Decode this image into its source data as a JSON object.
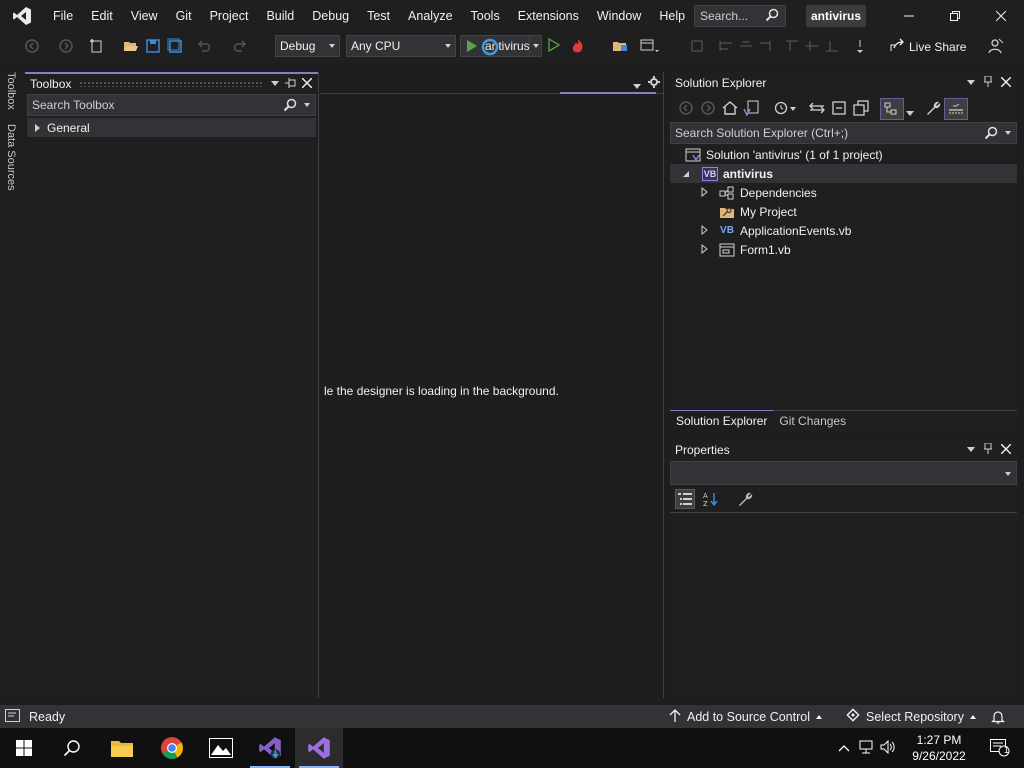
{
  "menu": {
    "items": [
      "File",
      "Edit",
      "View",
      "Git",
      "Project",
      "Build",
      "Debug",
      "Test",
      "Analyze",
      "Tools",
      "Extensions",
      "Window",
      "Help"
    ],
    "search_placeholder": "Search...",
    "solution_name": "antivirus"
  },
  "toolbar": {
    "configuration": "Debug",
    "platform": "Any CPU",
    "run_target": "antivirus",
    "live_share": "Live Share"
  },
  "side_tabs": [
    "Toolbox",
    "Data Sources"
  ],
  "toolbox": {
    "title": "Toolbox",
    "search_placeholder": "Search Toolbox",
    "groups": [
      "General"
    ]
  },
  "designer": {
    "loading_message": "le the designer is loading in the background."
  },
  "solution_explorer": {
    "title": "Solution Explorer",
    "search_placeholder": "Search Solution Explorer (Ctrl+;)",
    "solution_label": "Solution 'antivirus' (1 of 1 project)",
    "project": "antivirus",
    "items": [
      "Dependencies",
      "My Project",
      "ApplicationEvents.vb",
      "Form1.vb"
    ],
    "tabs": [
      "Solution Explorer",
      "Git Changes"
    ]
  },
  "properties": {
    "title": "Properties"
  },
  "statusbar": {
    "status": "Ready",
    "source_control": "Add to Source Control",
    "repository": "Select Repository"
  },
  "taskbar": {
    "time": "1:27 PM",
    "date": "9/26/2022",
    "notification_count": "1"
  },
  "colors": {
    "accent": "#8e7cc3",
    "vs_purple": "#7b5cc0",
    "run_green": "#57a64a"
  }
}
